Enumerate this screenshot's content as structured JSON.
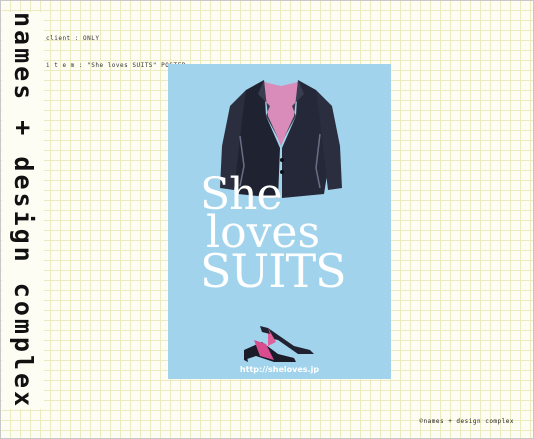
{
  "brand": {
    "vertical_text": "names + design complex"
  },
  "meta": {
    "client": "client : ONLY",
    "item": "i t e m : \"She loves SUITS\" POSTER"
  },
  "poster": {
    "headline": [
      "She",
      "loves",
      "SUITS"
    ],
    "url": "http://sheloves.jp",
    "background": "#a1d4ec"
  },
  "footer": {
    "credit": "©names + design complex"
  }
}
